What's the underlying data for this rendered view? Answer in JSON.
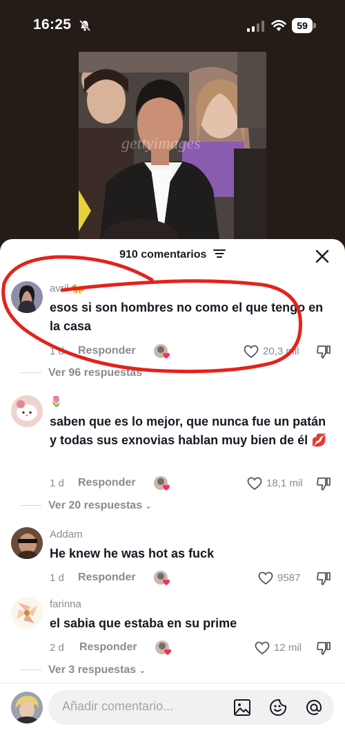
{
  "status": {
    "time": "16:25",
    "battery": "59"
  },
  "video": {
    "watermark": "gettyimages"
  },
  "comments_panel": {
    "count_label": "910 comentarios",
    "close_icon": "close-icon",
    "filter_icon": "sort-icon"
  },
  "comments": [
    {
      "username": "avril 🐆",
      "text": "esos si son hombres no como el que tengo en la casa",
      "time": "1 d",
      "reply_label": "Responder",
      "likes": "20,3 mil",
      "replies_label": "Ver 96 respuestas"
    },
    {
      "username": "🌷",
      "text": "saben que es lo mejor, que nunca fue un patán y todas sus exnovias hablan muy bien de él 💋",
      "time": "1 d",
      "reply_label": "Responder",
      "likes": "18,1 mil",
      "replies_label": "Ver 20 respuestas"
    },
    {
      "username": "Addam",
      "text": "He knew he was hot as fuck",
      "time": "1 d",
      "reply_label": "Responder",
      "likes": "9587"
    },
    {
      "username": "farinna",
      "text": "el sabia que estaba en su prime",
      "time": "2 d",
      "reply_label": "Responder",
      "likes": "12 mil",
      "replies_label": "Ver 3 respuestas"
    }
  ],
  "composer": {
    "placeholder": "Añadir comentario...",
    "icons": [
      "image-icon",
      "emoji-icon",
      "mention-icon"
    ]
  },
  "colors": {
    "annotation": "#e3231b",
    "like_heart": "#fe2c55",
    "text_secondary": "#8a8b91"
  }
}
